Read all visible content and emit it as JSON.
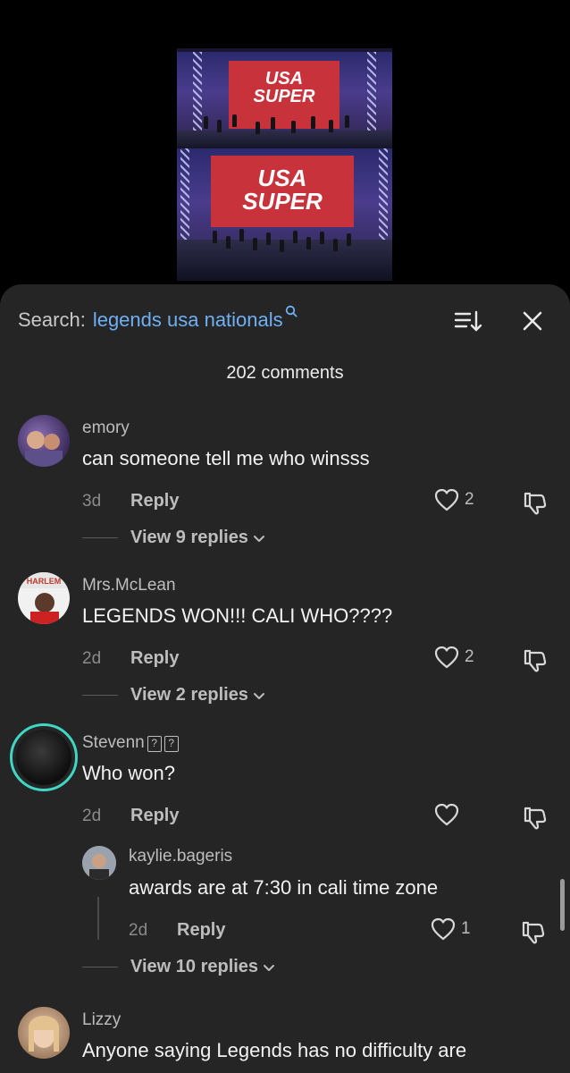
{
  "video": {
    "banner_top": "USA SUPER",
    "banner_bottom": "USA SUPER"
  },
  "search": {
    "prefix": "Search:",
    "term": "legends usa nationals"
  },
  "comments_count": "202 comments",
  "comments": [
    {
      "username": "emory",
      "text": "can someone tell me who winsss",
      "time": "3d",
      "reply": "Reply",
      "likes": "2",
      "view_replies": "View 9 replies"
    },
    {
      "username": "Mrs.McLean",
      "avatar_text": "HARLEM",
      "text": "LEGENDS WON!!! CALI WHO????",
      "time": "2d",
      "reply": "Reply",
      "likes": "2",
      "view_replies": "View 2 replies"
    },
    {
      "username": "Stevenn",
      "username_suffix": "??",
      "text": "Who won?",
      "time": "2d",
      "reply": "Reply",
      "likes": "",
      "view_replies": "View 10 replies",
      "reply_item": {
        "username": "kaylie.bageris",
        "text": "awards are at 7:30 in cali time zone",
        "time": "2d",
        "reply": "Reply",
        "likes": "1"
      }
    },
    {
      "username": "Lizzy",
      "text": "Anyone saying Legends has no difficulty are"
    }
  ],
  "colors": {
    "sheet_bg": "#252525",
    "search_term": "#6fb0f5",
    "story_ring": "#3fd6c4"
  }
}
